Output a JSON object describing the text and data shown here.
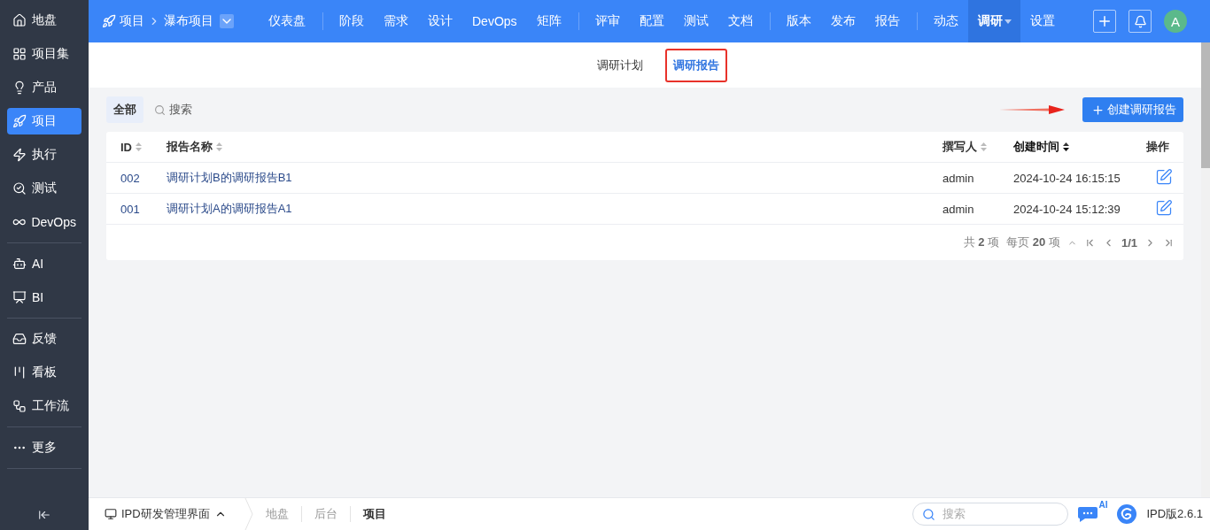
{
  "sidebar": {
    "groups": [
      {
        "items": [
          {
            "label": "地盘",
            "selected": false
          },
          {
            "label": "项目集",
            "selected": false
          },
          {
            "label": "产品",
            "selected": false
          },
          {
            "label": "项目",
            "selected": true
          },
          {
            "label": "执行",
            "selected": false
          },
          {
            "label": "测试",
            "selected": false
          },
          {
            "label": "DevOps",
            "selected": false
          }
        ]
      },
      {
        "items": [
          {
            "label": "AI",
            "selected": false
          },
          {
            "label": "BI",
            "selected": false
          }
        ]
      },
      {
        "items": [
          {
            "label": "反馈",
            "selected": false
          },
          {
            "label": "看板",
            "selected": false
          },
          {
            "label": "工作流",
            "selected": false
          }
        ]
      },
      {
        "items": [
          {
            "label": "更多",
            "selected": false
          }
        ]
      }
    ]
  },
  "topbar": {
    "breadcrumb": {
      "root": "项目",
      "current": "瀑布项目"
    },
    "nav_groups": [
      {
        "items": [
          {
            "label": "仪表盘",
            "selected": false
          }
        ]
      },
      {
        "items": [
          {
            "label": "阶段",
            "selected": false
          },
          {
            "label": "需求",
            "selected": false
          },
          {
            "label": "设计",
            "selected": false
          },
          {
            "label": "DevOps",
            "selected": false
          },
          {
            "label": "矩阵",
            "selected": false
          }
        ]
      },
      {
        "items": [
          {
            "label": "评审",
            "selected": false
          },
          {
            "label": "配置",
            "selected": false
          },
          {
            "label": "测试",
            "selected": false
          },
          {
            "label": "文档",
            "selected": false
          }
        ]
      },
      {
        "items": [
          {
            "label": "版本",
            "selected": false
          },
          {
            "label": "发布",
            "selected": false
          },
          {
            "label": "报告",
            "selected": false
          }
        ]
      },
      {
        "items": [
          {
            "label": "动态",
            "selected": false
          },
          {
            "label": "调研",
            "selected": true,
            "dropdown": true
          },
          {
            "label": "设置",
            "selected": false
          }
        ]
      }
    ],
    "avatar": "A"
  },
  "subtabs": [
    {
      "label": "调研计划",
      "selected": false,
      "highlighted": false
    },
    {
      "label": "调研报告",
      "selected": true,
      "highlighted": true
    }
  ],
  "toolbar": {
    "filters": [
      {
        "label": "全部",
        "selected": true
      }
    ],
    "search": "搜索",
    "create_button": "创建调研报告",
    "arrow_annotation": true
  },
  "table": {
    "columns": [
      {
        "label": "ID",
        "sortable": true,
        "sorted_desc": false
      },
      {
        "label": "报告名称",
        "sortable": true,
        "sorted_desc": false
      },
      {
        "label": "撰写人",
        "sortable": true,
        "sorted_desc": false
      },
      {
        "label": "创建时间",
        "sortable": true,
        "sorted_desc": true
      },
      {
        "label": "操作",
        "sortable": false,
        "sorted_desc": false
      }
    ],
    "rows": [
      {
        "id": "002",
        "name": "调研计划B的调研报告B1",
        "author": "admin",
        "created": "2024-10-24 16:15:15"
      },
      {
        "id": "001",
        "name": "调研计划A的调研报告A1",
        "author": "admin",
        "created": "2024-10-24 15:12:39"
      }
    ],
    "pagination": {
      "total": "共 **2** 项",
      "per_page": "每页 **20** 项",
      "page": "1/1"
    }
  },
  "footer": {
    "app": "IPD研发管理界面",
    "crumbs": [
      {
        "label": "地盘",
        "selected": false
      },
      {
        "label": "后台",
        "selected": false
      },
      {
        "label": "项目",
        "selected": true
      }
    ],
    "search_placeholder": "搜索",
    "ai_badge": "AI",
    "version": "IPD版2.6.1"
  }
}
